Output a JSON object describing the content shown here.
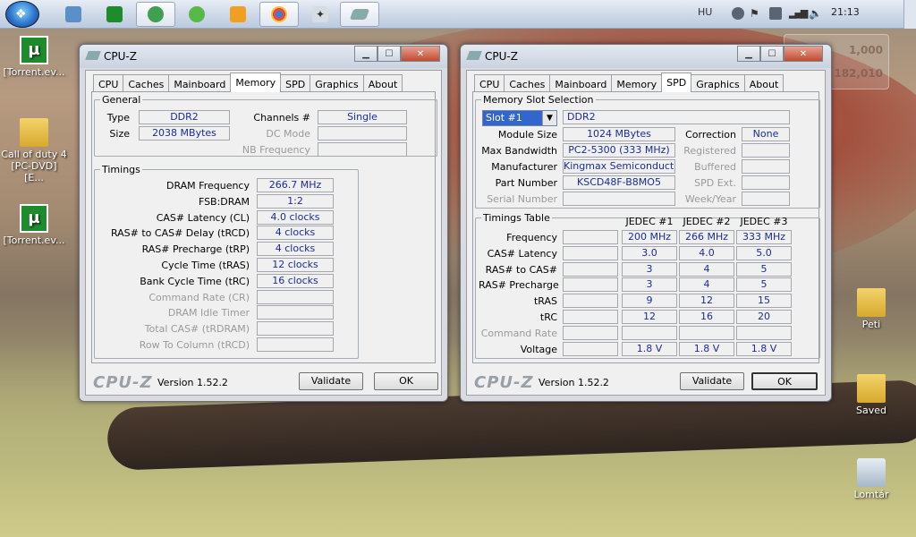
{
  "taskbar": {
    "language": "HU",
    "clock": "21:13"
  },
  "desktop": {
    "icons": [
      {
        "label": "[Torrent.ev..."
      },
      {
        "label": "Call of duty 4 [PC-DVD] [E..."
      },
      {
        "label": "[Torrent.ev..."
      },
      {
        "label": "Peti"
      },
      {
        "label": "Saved"
      },
      {
        "label": "Lomtár"
      }
    ],
    "ghost_values": [
      "1,000",
      "182,010"
    ]
  },
  "win1": {
    "title": "CPU-Z",
    "tabs": [
      "CPU",
      "Caches",
      "Mainboard",
      "Memory",
      "SPD",
      "Graphics",
      "About"
    ],
    "active_tab": "Memory",
    "general": {
      "legend": "General",
      "type_label": "Type",
      "type": "DDR2",
      "size_label": "Size",
      "size": "2038 MBytes",
      "channels_label": "Channels #",
      "channels": "Single",
      "dcmode_label": "DC Mode",
      "dcmode": "",
      "nbfreq_label": "NB Frequency",
      "nbfreq": ""
    },
    "timings": {
      "legend": "Timings",
      "rows": [
        {
          "label": "DRAM Frequency",
          "value": "266.7 MHz",
          "disabled": false
        },
        {
          "label": "FSB:DRAM",
          "value": "1:2",
          "disabled": false
        },
        {
          "label": "CAS# Latency (CL)",
          "value": "4.0 clocks",
          "disabled": false
        },
        {
          "label": "RAS# to CAS# Delay (tRCD)",
          "value": "4 clocks",
          "disabled": false
        },
        {
          "label": "RAS# Precharge (tRP)",
          "value": "4 clocks",
          "disabled": false
        },
        {
          "label": "Cycle Time (tRAS)",
          "value": "12 clocks",
          "disabled": false
        },
        {
          "label": "Bank Cycle Time (tRC)",
          "value": "16 clocks",
          "disabled": false
        },
        {
          "label": "Command Rate (CR)",
          "value": "",
          "disabled": true
        },
        {
          "label": "DRAM Idle Timer",
          "value": "",
          "disabled": true
        },
        {
          "label": "Total CAS# (tRDRAM)",
          "value": "",
          "disabled": true
        },
        {
          "label": "Row To Column (tRCD)",
          "value": "",
          "disabled": true
        }
      ]
    },
    "footer": {
      "brand": "CPU-Z",
      "version": "Version 1.52.2",
      "validate": "Validate",
      "ok": "OK"
    }
  },
  "win2": {
    "title": "CPU-Z",
    "tabs": [
      "CPU",
      "Caches",
      "Mainboard",
      "Memory",
      "SPD",
      "Graphics",
      "About"
    ],
    "active_tab": "SPD",
    "slot": {
      "legend": "Memory Slot Selection",
      "selected": "Slot #1",
      "type": "DDR2",
      "module_size_label": "Module Size",
      "module_size": "1024 MBytes",
      "max_bw_label": "Max Bandwidth",
      "max_bw": "PC2-5300 (333 MHz)",
      "manufacturer_label": "Manufacturer",
      "manufacturer": "Kingmax Semiconductor",
      "part_label": "Part Number",
      "part": "KSCD48F-B8MO5",
      "serial_label": "Serial Number",
      "serial": "",
      "correction_label": "Correction",
      "correction": "None",
      "registered_label": "Registered",
      "registered": "",
      "buffered_label": "Buffered",
      "buffered": "",
      "spdext_label": "SPD Ext.",
      "spdext": "",
      "week_label": "Week/Year",
      "week": ""
    },
    "timings_table": {
      "legend": "Timings Table",
      "headers": [
        "JEDEC #1",
        "JEDEC #2",
        "JEDEC #3"
      ],
      "rows": [
        {
          "label": "Frequency",
          "values": [
            "200 MHz",
            "266 MHz",
            "333 MHz"
          ],
          "disabled": false
        },
        {
          "label": "CAS# Latency",
          "values": [
            "3.0",
            "4.0",
            "5.0"
          ],
          "disabled": false
        },
        {
          "label": "RAS# to CAS#",
          "values": [
            "3",
            "4",
            "5"
          ],
          "disabled": false
        },
        {
          "label": "RAS# Precharge",
          "values": [
            "3",
            "4",
            "5"
          ],
          "disabled": false
        },
        {
          "label": "tRAS",
          "values": [
            "9",
            "12",
            "15"
          ],
          "disabled": false
        },
        {
          "label": "tRC",
          "values": [
            "12",
            "16",
            "20"
          ],
          "disabled": false
        },
        {
          "label": "Command Rate",
          "values": [
            "",
            "",
            ""
          ],
          "disabled": true
        },
        {
          "label": "Voltage",
          "values": [
            "1.8 V",
            "1.8 V",
            "1.8 V"
          ],
          "disabled": false
        }
      ]
    },
    "footer": {
      "brand": "CPU-Z",
      "version": "Version 1.52.2",
      "validate": "Validate",
      "ok": "OK"
    }
  }
}
